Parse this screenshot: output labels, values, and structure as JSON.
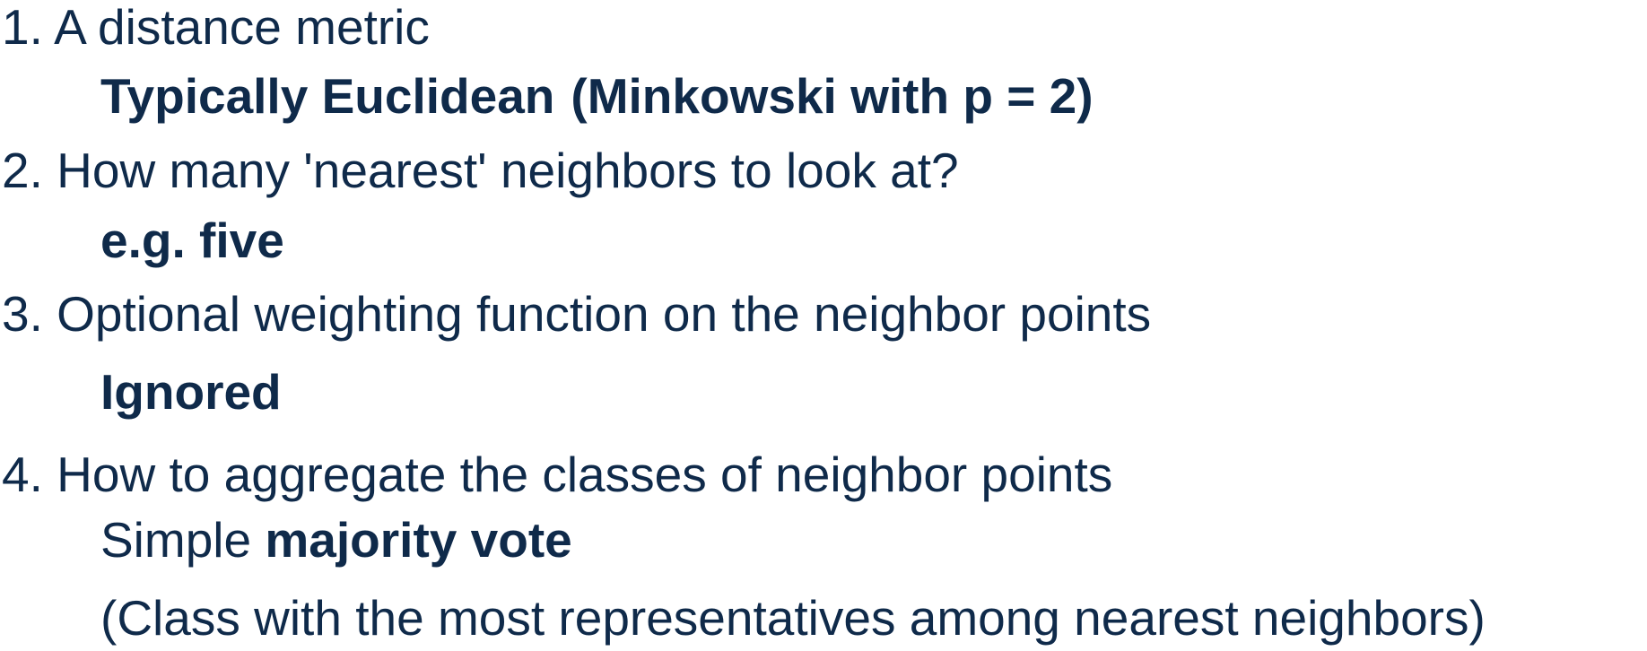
{
  "items": [
    {
      "heading": "1. A distance metric",
      "detail_parts": [
        "Typically Euclidean",
        "(Minkowski with p = 2)"
      ]
    },
    {
      "heading": "2. How many 'nearest' neighbors to look at?",
      "detail": "e.g. five"
    },
    {
      "heading": "3. Optional weighting function on the neighbor points",
      "detail": "Ignored"
    },
    {
      "heading": "4. How to aggregate the classes of neighbor points",
      "detail_prefix": "Simple",
      "detail_bold": "majority vote",
      "detail_note": "(Class with the most representatives among nearest neighbors)"
    }
  ],
  "colors": {
    "text": "#0f2a4a",
    "background": "#ffffff"
  }
}
